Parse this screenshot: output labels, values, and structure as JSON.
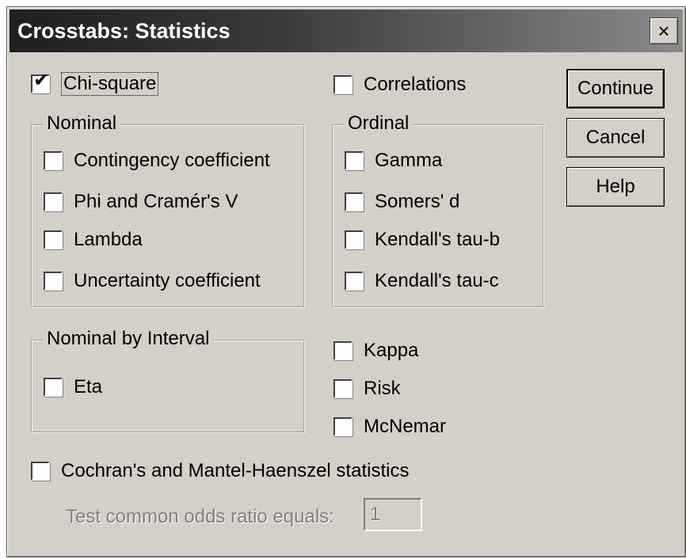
{
  "window": {
    "title": "Crosstabs: Statistics",
    "close_glyph": "×"
  },
  "check_glyph": "✔",
  "chi_square": {
    "label": "Chi-square",
    "checked": true
  },
  "correlations": {
    "label": "Correlations",
    "checked": false
  },
  "nominal": {
    "title": "Nominal",
    "items": [
      {
        "label": "Contingency coefficient",
        "checked": false
      },
      {
        "label": "Phi and Cramér's V",
        "checked": false
      },
      {
        "label": "Lambda",
        "checked": false
      },
      {
        "label": "Uncertainty coefficient",
        "checked": false
      }
    ]
  },
  "ordinal": {
    "title": "Ordinal",
    "items": [
      {
        "label": "Gamma",
        "checked": false
      },
      {
        "label": "Somers' d",
        "checked": false
      },
      {
        "label": "Kendall's tau-b",
        "checked": false
      },
      {
        "label": "Kendall's tau-c",
        "checked": false
      }
    ]
  },
  "nominal_by_interval": {
    "title": "Nominal by Interval",
    "items": [
      {
        "label": "Eta",
        "checked": false
      }
    ]
  },
  "other": [
    {
      "label": "Kappa",
      "checked": false
    },
    {
      "label": "Risk",
      "checked": false
    },
    {
      "label": "McNemar",
      "checked": false
    }
  ],
  "cochran": {
    "label": "Cochran's and Mantel-Haenszel statistics",
    "checked": false
  },
  "odds_ratio": {
    "label": "Test common odds ratio equals:",
    "value": "1"
  },
  "buttons": {
    "continue": "Continue",
    "cancel": "Cancel",
    "help": "Help"
  }
}
